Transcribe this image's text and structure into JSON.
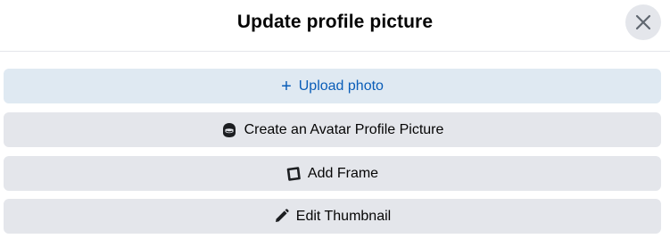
{
  "dialog": {
    "title": "Update profile picture",
    "close_icon": "close-icon"
  },
  "actions": [
    {
      "label": "Upload photo",
      "icon": "plus-icon",
      "style": "primary"
    },
    {
      "label": "Create an Avatar Profile Picture",
      "icon": "avatar-icon",
      "style": "secondary"
    },
    {
      "label": "Add Frame",
      "icon": "frame-icon",
      "style": "secondary"
    },
    {
      "label": "Edit Thumbnail",
      "icon": "pencil-icon",
      "style": "secondary"
    }
  ],
  "colors": {
    "primary_bg": "#dfe9f2",
    "primary_text": "#0a5db8",
    "secondary_bg": "#e4e6eb",
    "text": "#050505"
  },
  "icons": {
    "plus": "+"
  }
}
